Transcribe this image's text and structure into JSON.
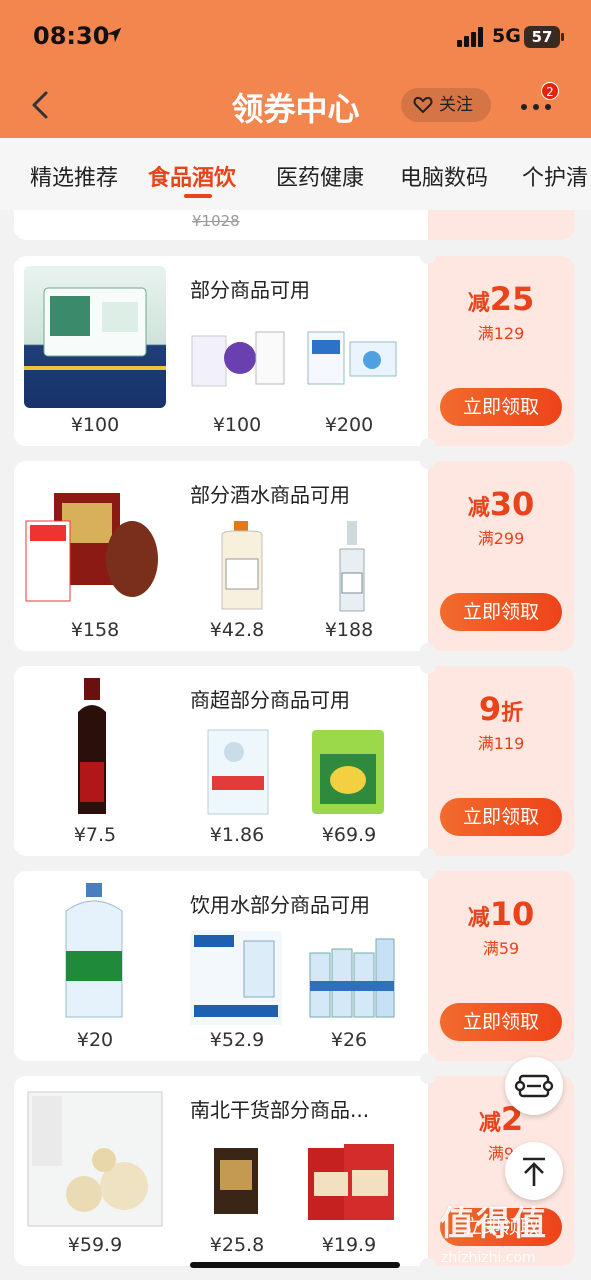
{
  "status": {
    "time": "08:30",
    "network": "5G",
    "battery": "57"
  },
  "nav": {
    "title": "领券中心",
    "follow_label": "关注",
    "badge_count": "2"
  },
  "tabs": [
    {
      "label": "精选推荐",
      "active": false
    },
    {
      "label": "食品酒饮",
      "active": true
    },
    {
      "label": "医药健康",
      "active": false
    },
    {
      "label": "电脑数码",
      "active": false
    },
    {
      "label": "个护清",
      "active": false
    }
  ],
  "partial_card": {
    "old_price": "¥1028"
  },
  "cards": [
    {
      "title": "部分商品可用",
      "prices": [
        "¥100",
        "¥100",
        "¥200"
      ],
      "coupon": {
        "prefix": "减",
        "amount": "25",
        "suffix": "",
        "condition": "满129",
        "button": "立即领取"
      }
    },
    {
      "title": "部分酒水商品可用",
      "prices": [
        "¥158",
        "¥42.8",
        "¥188"
      ],
      "coupon": {
        "prefix": "减",
        "amount": "30",
        "suffix": "",
        "condition": "满299",
        "button": "立即领取"
      }
    },
    {
      "title": "商超部分商品可用",
      "prices": [
        "¥7.5",
        "¥1.86",
        "¥69.9"
      ],
      "coupon": {
        "prefix": "",
        "amount": "9",
        "suffix": "折",
        "condition": "满119",
        "button": "立即领取"
      }
    },
    {
      "title": "饮用水部分商品可用",
      "prices": [
        "¥20",
        "¥52.9",
        "¥26"
      ],
      "coupon": {
        "prefix": "减",
        "amount": "10",
        "suffix": "",
        "condition": "满59",
        "button": "立即领取"
      }
    },
    {
      "title": "南北干货部分商品...",
      "prices": [
        "¥59.9",
        "¥25.8",
        "¥19.9"
      ],
      "coupon": {
        "prefix": "减",
        "amount": "2",
        "suffix": "",
        "condition": "满9",
        "button": "立即领取"
      }
    }
  ],
  "watermark": {
    "main": "值得值",
    "sub": "zhizhizhi.com"
  },
  "colors": {
    "header": "#f3854f",
    "accent": "#e8431b",
    "coupon_bg": "#fde7e0"
  }
}
